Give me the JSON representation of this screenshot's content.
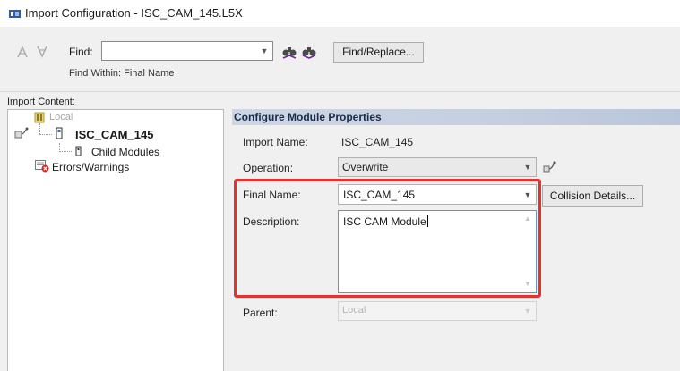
{
  "window": {
    "title": "Import Configuration - ISC_CAM_145.L5X",
    "icon": "import-window-icon"
  },
  "toolbar": {
    "prev_icon": "previous-match-icon",
    "next_icon": "next-match-icon",
    "find_label": "Find:",
    "find_value": "",
    "find_within": "Find Within: Final Name",
    "find_up_icon": "find-up-binoculars-icon",
    "find_down_icon": "find-down-binoculars-icon",
    "find_replace_label": "Find/Replace..."
  },
  "import_content": {
    "label": "Import Content:",
    "tree": {
      "root": "Local",
      "module": "ISC_CAM_145",
      "child_modules": "Child Modules",
      "errors_warnings": "Errors/Warnings"
    }
  },
  "configure": {
    "title": "Configure Module Properties",
    "import_name_label": "Import Name:",
    "import_name_value": "ISC_CAM_145",
    "operation_label": "Operation:",
    "operation_value": "Overwrite",
    "final_name_label": "Final Name:",
    "final_name_value": "ISC_CAM_145",
    "collision_details_label": "Collision Details...",
    "description_label": "Description:",
    "description_value": "ISC CAM Module",
    "parent_label": "Parent:",
    "parent_value": "Local"
  },
  "colors": {
    "highlight": "#e5322d",
    "header_band": "#c4cfe0",
    "module_icon_blue": "#3a63b8",
    "error_red": "#d9281e"
  }
}
